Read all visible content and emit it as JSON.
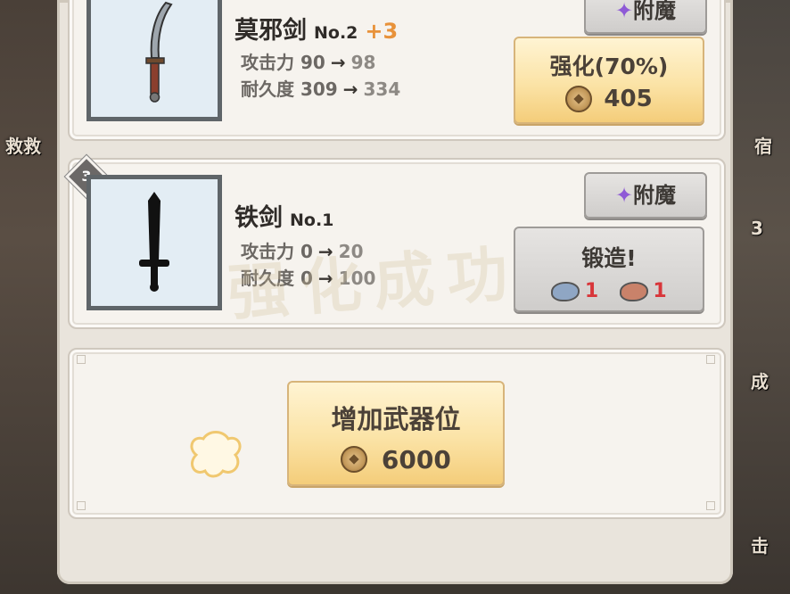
{
  "side": {
    "left_top": "救救",
    "right_top": "宿",
    "right_num": "3",
    "right_mid": "成",
    "right_bot": "击"
  },
  "weapons": [
    {
      "name": "莫邪剑",
      "no": "No.2",
      "plus": "+3",
      "attack_label": "攻击力",
      "attack_from": "90",
      "attack_to": "98",
      "durability_label": "耐久度",
      "durability_from": "309",
      "durability_to": "334",
      "enchant_label": "附魔",
      "action_label": "强化(70%)",
      "cost": "405"
    },
    {
      "badge": "3",
      "name": "铁剑",
      "no": "No.1",
      "attack_label": "攻击力",
      "attack_from": "0",
      "attack_to": "20",
      "durability_label": "耐久度",
      "durability_from": "0",
      "durability_to": "100",
      "enchant_label": "附魔",
      "action_label": "锻造!",
      "materials": [
        {
          "icon": "iron-ore-icon",
          "count": "1"
        },
        {
          "icon": "copper-ore-icon",
          "count": "1"
        }
      ]
    }
  ],
  "add_slot": {
    "label": "增加武器位",
    "cost": "6000"
  },
  "arrow_glyph": "→",
  "watermark": "强化成功",
  "colors": {
    "gold_button": "#fbe3a6",
    "plus_orange": "#e8923a",
    "material_red": "#d8363a"
  }
}
